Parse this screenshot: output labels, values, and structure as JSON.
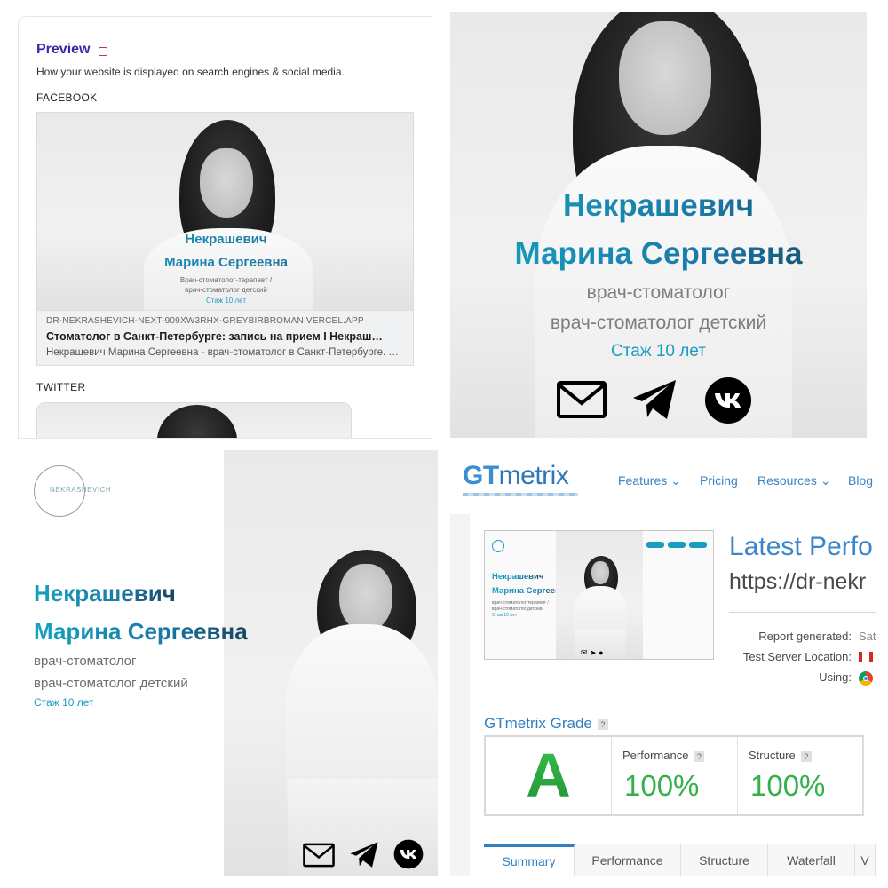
{
  "preview": {
    "title": "Preview",
    "description": "How your website is displayed on search engines & social media.",
    "facebook_label": "FACEBOOK",
    "twitter_label": "TWITTER",
    "facebook_card": {
      "name_line1": "Некрашевич",
      "name_line2": "Марина Сергеевна",
      "job_line1": "Врач-стоматолог-терапевт /",
      "job_line2": "врач-стоматолог детский",
      "experience": "Стаж 10 лет",
      "url": "DR-NEKRASHEVICH-NEXT-909XW3RHX-GREYBIRBROMAN.VERCEL.APP",
      "title": "Стоматолог в Санкт-Петербурге: запись на прием I Некраш…",
      "description": "Некрашевич Марина Сергеевна - врач-стоматолог в Санкт-Петербурге. …"
    }
  },
  "hero_large": {
    "name_line1": "Некрашевич",
    "name_line2": "Марина Сергеевна",
    "job_line1": "врач-стоматолог",
    "job_line2": "врач-стоматолог детский",
    "experience": "Стаж 10 лет",
    "icons": [
      "mail-icon",
      "telegram-icon",
      "vk-icon"
    ]
  },
  "hero_split": {
    "logo_text": "NEKRASHEVICH",
    "name_line1": "Некрашевич",
    "name_line2": "Марина Сергеевна",
    "job_line1": "врач-стоматолог",
    "job_line2": "врач-стоматолог детский",
    "experience": "Стаж 10 лет",
    "icons": [
      "mail-icon",
      "telegram-icon",
      "vk-icon"
    ]
  },
  "gtmetrix": {
    "brand_gt": "GT",
    "brand_metrix": "metrix",
    "nav": [
      "Features",
      "Pricing",
      "Resources",
      "Blog"
    ],
    "thumb": {
      "name_line1": "Некрашевич",
      "name_line2": "Марина Сергеевна",
      "job_line1": "врач-стоматолог-терапевт /",
      "job_line2": "врач-стоматолог детский",
      "experience": "Стаж 10 лет"
    },
    "heading": "Latest Perfo",
    "url": "https://dr-nekr",
    "report_generated_label": "Report generated:",
    "report_generated_value": "Sat",
    "server_location_label": "Test Server Location:",
    "using_label": "Using:",
    "grade_title": "GTmetrix Grade",
    "grade": "A",
    "performance_label": "Performance",
    "performance_value": "100%",
    "structure_label": "Structure",
    "structure_value": "100%",
    "help_mark": "?",
    "tabs": [
      "Summary",
      "Performance",
      "Structure",
      "Waterfall",
      "V"
    ],
    "colors": {
      "accent": "#2f7fc1",
      "grade_green": "#33b04a"
    }
  }
}
